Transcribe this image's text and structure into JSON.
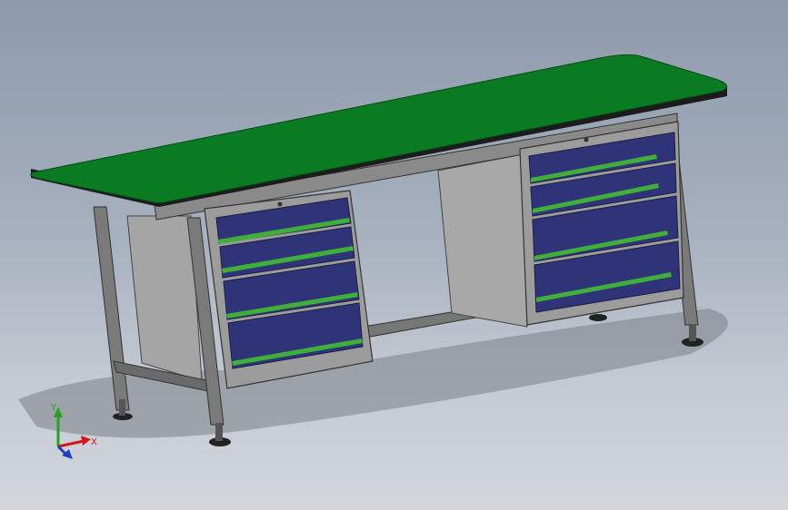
{
  "viewport": {
    "background_top": "#8e9aab",
    "background_bottom": "#d3d7dc"
  },
  "model": {
    "top_color": "#0a7a23",
    "top_edge_color": "#1c1c1c",
    "frame_color": "#6e6e6e",
    "panel_color": "#9a9a9a",
    "drawer_color": "#2f3478",
    "handle_color": "#3fae3a",
    "left_cabinet_drawers": 4,
    "right_cabinet_drawers": 4
  },
  "triad": {
    "x_label": "X",
    "y_label": "Y",
    "x_color": "#d0181b",
    "y_color": "#28a020",
    "z_color": "#2040c0"
  }
}
